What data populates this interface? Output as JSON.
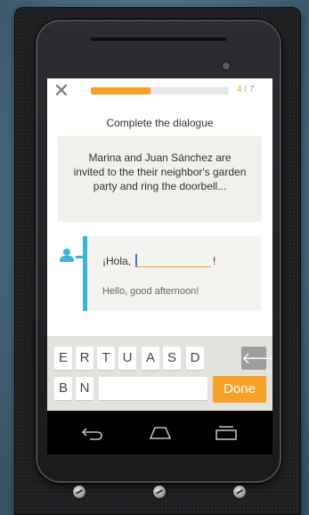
{
  "header": {
    "close_icon": "close-icon",
    "progress": {
      "current": "4",
      "separator": " / ",
      "total": "7",
      "fraction": 0.43
    }
  },
  "lesson": {
    "instruction": "Complete the dialogue",
    "context": "Marina and Juan Sánchez are invited to the their neighbor's garden party and ring  the doorbell..."
  },
  "dialogue": {
    "speaker_icon": "person-icon",
    "line_prefix": "¡Hola,",
    "line_suffix": "!",
    "answer_value": "",
    "translation": "Hello, good afternoon!"
  },
  "keyboard": {
    "row1": [
      "E",
      "R",
      "T",
      "U",
      "A",
      "S",
      "D"
    ],
    "row2": [
      "B",
      "N"
    ],
    "backspace_icon": "arrow-left-icon",
    "done_label": "Done"
  },
  "navbar": {
    "back_icon": "back-icon",
    "home_icon": "home-icon",
    "recents_icon": "recents-icon"
  },
  "colors": {
    "accent_orange": "#f5a12a",
    "accent_blue": "#3bb5d6"
  }
}
